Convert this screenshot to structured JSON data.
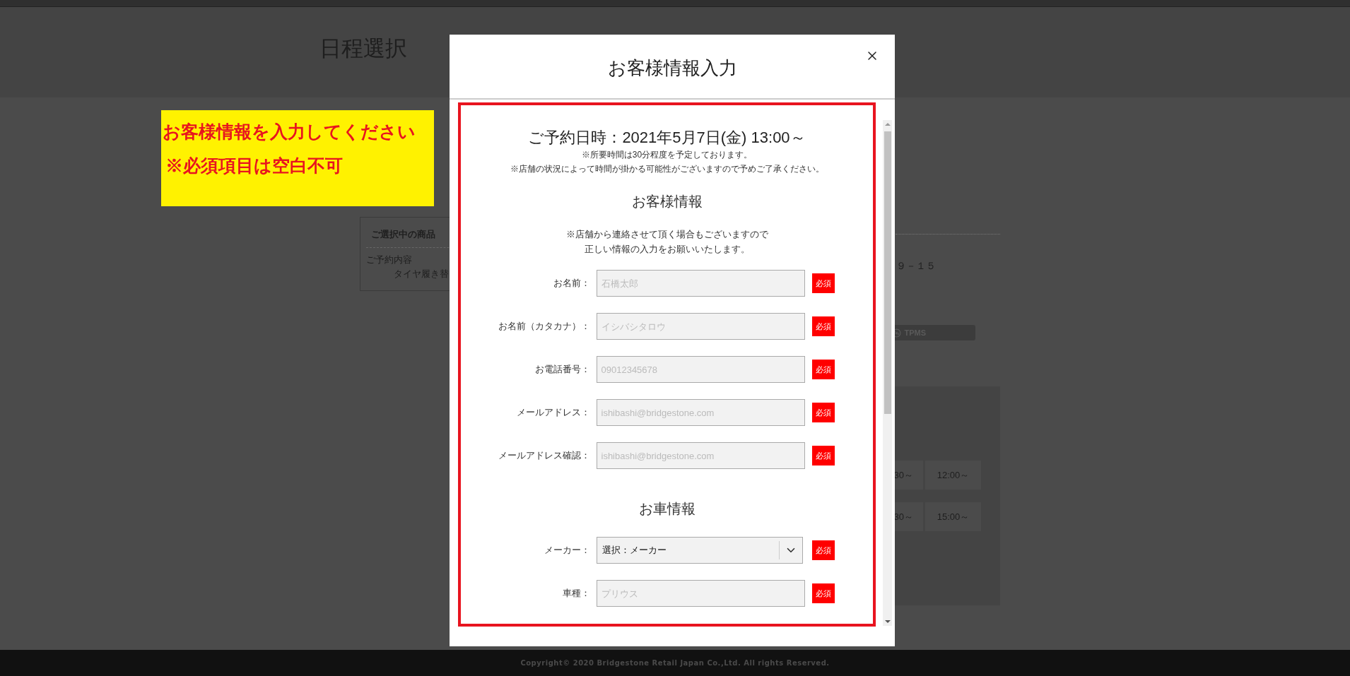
{
  "page": {
    "title": "日程選択"
  },
  "notice": {
    "lines": [
      "お客様情報を入力してください",
      "※必須項目は空白不可"
    ]
  },
  "selected_product": {
    "heading": "ご選択中の商品",
    "label": "ご予約内容",
    "value": "タイヤ履き替"
  },
  "store": {
    "address": "９－１５",
    "tpms_button": "TPMS"
  },
  "time_slots": [
    {
      "label": "30～"
    },
    {
      "label": "12:00～"
    },
    {
      "label": "30～"
    },
    {
      "label": "15:00～"
    }
  ],
  "modal": {
    "title": "お客様情報入力",
    "reservation": "ご予約日時：2021年5月7日(金) 13:00～",
    "notes": [
      "※所要時間は30分程度を予定しております。",
      "※店舗の状況によって時間が掛かる可能性がございますので予めご了承ください。"
    ],
    "sections": [
      {
        "heading": "お客様情報",
        "notes": [
          "※店舗から連絡させて頂く場合もございますので",
          "正しい情報の入力をお願いいたします。"
        ],
        "fields": [
          {
            "kind": "text",
            "label": "お名前：",
            "placeholder": "石橋太郎",
            "badge": "必須"
          },
          {
            "kind": "text",
            "label": "お名前（カタカナ）：",
            "placeholder": "イシバシタロウ",
            "badge": "必須"
          },
          {
            "kind": "text",
            "label": "お電話番号：",
            "placeholder": "09012345678",
            "badge": "必須"
          },
          {
            "kind": "text",
            "label": "メールアドレス：",
            "placeholder": "ishibashi@bridgestone.com",
            "badge": "必須"
          },
          {
            "kind": "text",
            "label": "メールアドレス確認：",
            "placeholder": "ishibashi@bridgestone.com",
            "badge": "必須"
          }
        ]
      },
      {
        "heading": "お車情報",
        "fields": [
          {
            "kind": "select",
            "label": "メーカー：",
            "value": "選択：メーカー",
            "badge": "必須"
          },
          {
            "kind": "text",
            "label": "車種：",
            "placeholder": "プリウス",
            "badge": "必須"
          }
        ]
      }
    ]
  },
  "footer": {
    "copyright": "Copyright© 2020 Bridgestone Retail Japan Co.,Ltd. All rights Reserved."
  }
}
